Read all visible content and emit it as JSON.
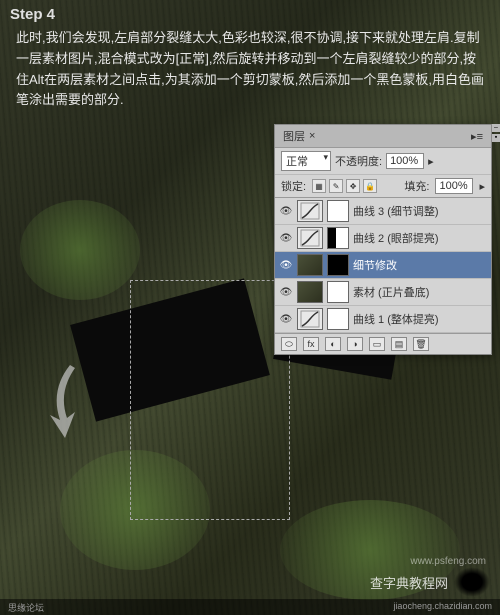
{
  "step_label": "Step 4",
  "instruction": "此时,我们会发现,左肩部分裂缝太大,色彩也较深,很不协调,接下来就处理左肩.复制一层素材图片,混合模式改为[正常],然后旋转并移动到一个左肩裂缝较少的部分,按住Alt在两层素材之间点击,为其添加一个剪切蒙板,然后添加一个黑色蒙板,用白色画笔涂出需要的部分.",
  "panel": {
    "tab_label": "图层",
    "close_x": "×",
    "blend_mode": "正常",
    "opacity_label": "不透明度:",
    "opacity_value": "100%",
    "lock_label": "锁定:",
    "fill_label": "填充:",
    "fill_value": "100%",
    "layers": [
      {
        "name": "曲线 3 (细节调整)",
        "type": "curves",
        "mask": "white",
        "selected": false,
        "visible": true
      },
      {
        "name": "曲线 2 (眼部提亮)",
        "type": "curves",
        "mask": "partial",
        "selected": false,
        "visible": true
      },
      {
        "name": "细节修改",
        "type": "image",
        "mask": "black",
        "selected": true,
        "visible": true
      },
      {
        "name": "素材 (正片叠底)",
        "type": "image",
        "mask": "white",
        "selected": false,
        "visible": true
      },
      {
        "name": "曲线 1 (整体提亮)",
        "type": "curves",
        "mask": "white",
        "selected": false,
        "visible": true
      }
    ]
  },
  "watermark": {
    "site": "查字典教程网",
    "domain": "www.psfeng.com",
    "url": "jiaocheng.chazidian.com",
    "forum": "思缘论坛"
  }
}
